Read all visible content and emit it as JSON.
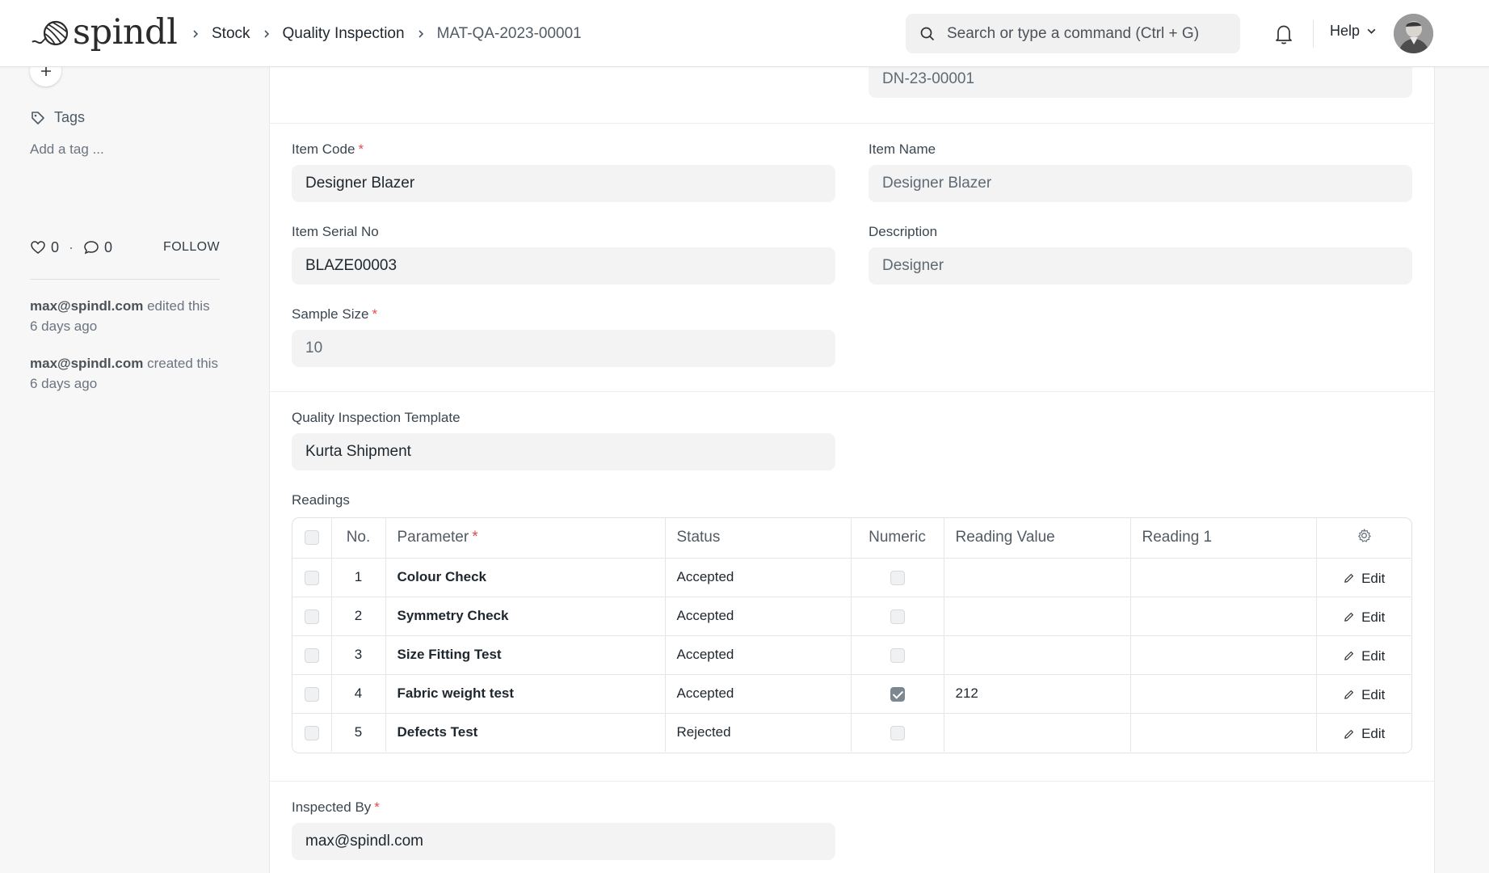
{
  "brand": {
    "name": "spindl"
  },
  "breadcrumbs": [
    "Stock",
    "Quality Inspection",
    "MAT-QA-2023-00001"
  ],
  "search": {
    "placeholder": "Search or type a command (Ctrl + G)"
  },
  "help_label": "Help",
  "sidebar": {
    "tags_label": "Tags",
    "add_tag": "Add a tag ...",
    "likes": "0",
    "comments": "0",
    "follow": "FOLLOW",
    "activity": [
      {
        "user": "max@spindl.com",
        "action": "edited this",
        "time": "6 days ago"
      },
      {
        "user": "max@spindl.com",
        "action": "created this",
        "time": "6 days ago"
      }
    ]
  },
  "form": {
    "reference_value": "DN-23-00001",
    "item_code": {
      "label": "Item Code",
      "value": "Designer Blazer"
    },
    "item_name": {
      "label": "Item Name",
      "value": "Designer Blazer"
    },
    "item_serial_no": {
      "label": "Item Serial No",
      "value": "BLAZE00003"
    },
    "description": {
      "label": "Description",
      "value": "Designer"
    },
    "sample_size": {
      "label": "Sample Size",
      "value": "10"
    },
    "template": {
      "label": "Quality Inspection Template",
      "value": "Kurta Shipment"
    },
    "readings_label": "Readings",
    "inspected_by": {
      "label": "Inspected By",
      "value": "max@spindl.com"
    },
    "required_mark": "*"
  },
  "readings": {
    "columns": [
      "No.",
      "Parameter",
      "Status",
      "Numeric",
      "Reading Value",
      "Reading 1"
    ],
    "edit_label": "Edit",
    "rows": [
      {
        "no": "1",
        "parameter": "Colour Check",
        "status": "Accepted",
        "numeric": false,
        "reading_value": "",
        "reading_1": ""
      },
      {
        "no": "2",
        "parameter": "Symmetry Check",
        "status": "Accepted",
        "numeric": false,
        "reading_value": "",
        "reading_1": ""
      },
      {
        "no": "3",
        "parameter": "Size Fitting Test",
        "status": "Accepted",
        "numeric": false,
        "reading_value": "",
        "reading_1": ""
      },
      {
        "no": "4",
        "parameter": "Fabric weight test",
        "status": "Accepted",
        "numeric": true,
        "reading_value": "212",
        "reading_1": ""
      },
      {
        "no": "5",
        "parameter": "Defects Test",
        "status": "Rejected",
        "numeric": false,
        "reading_value": "",
        "reading_1": ""
      }
    ]
  }
}
